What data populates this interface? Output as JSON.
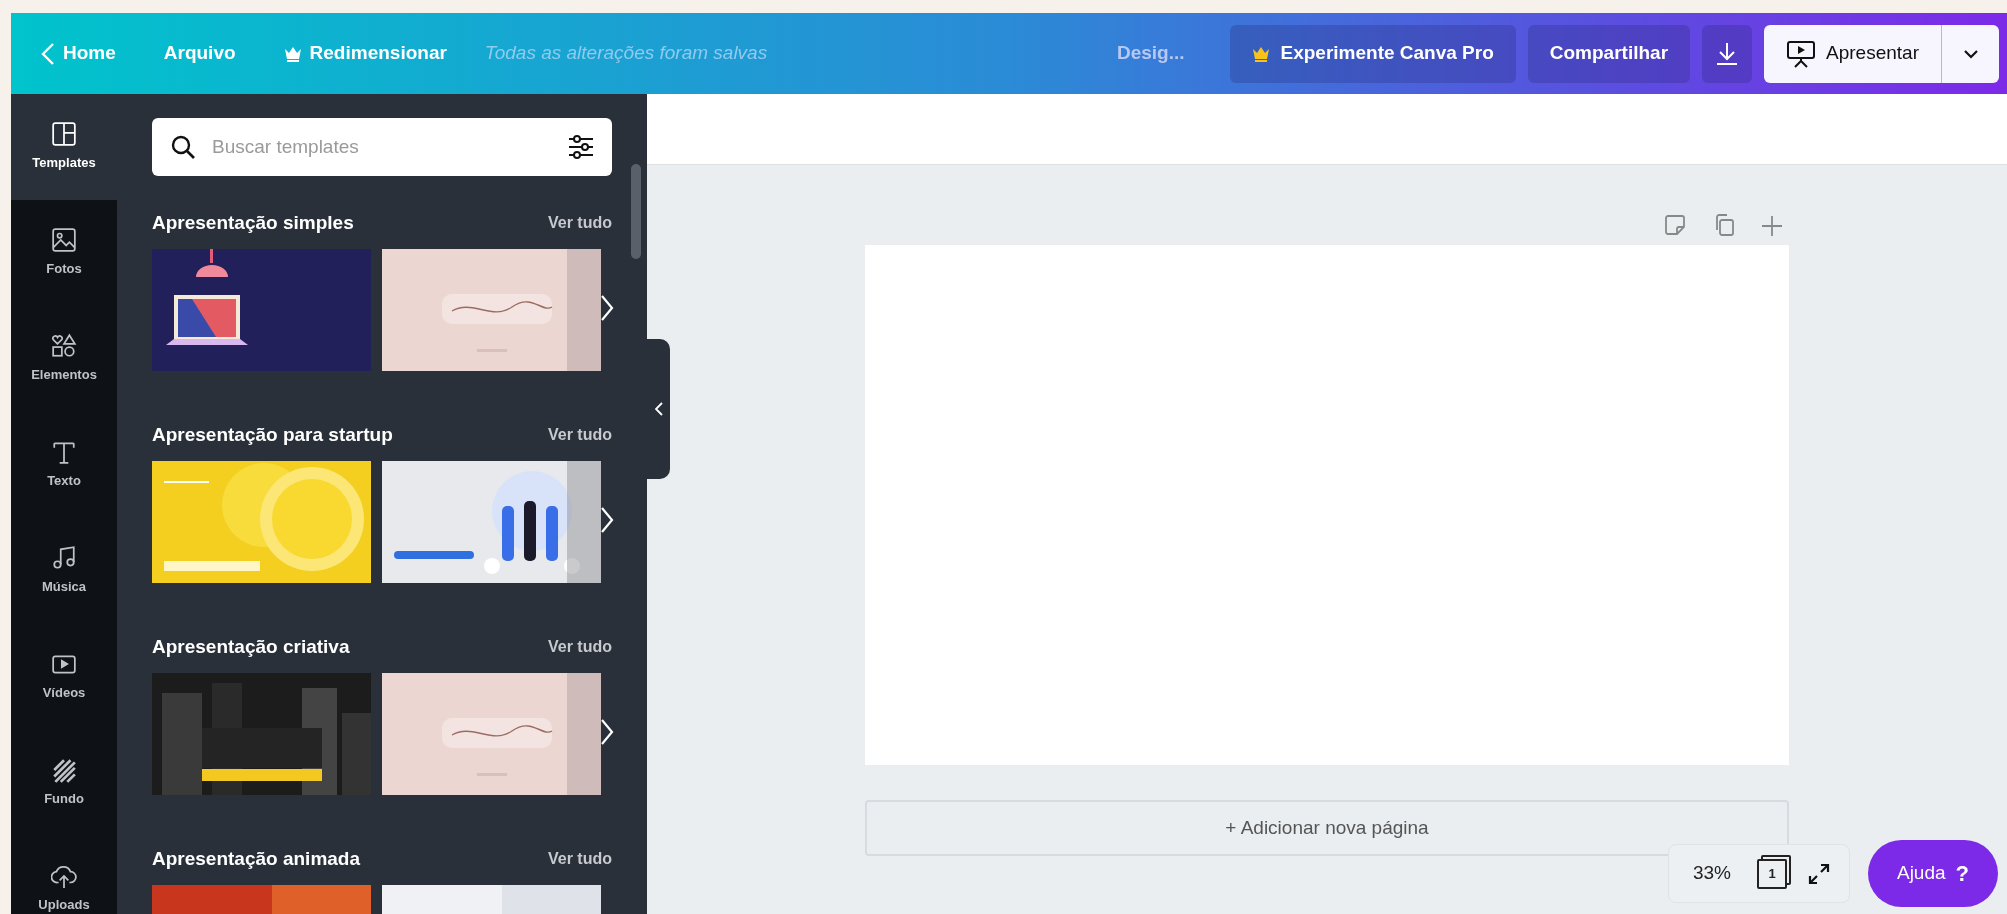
{
  "topbar": {
    "home": "Home",
    "menu": [
      {
        "label": "Arquivo",
        "kind": "plain"
      },
      {
        "label": "Redimensionar",
        "kind": "crown"
      }
    ],
    "status": "Todas as alterações foram salvas",
    "design_title": "Desig...",
    "pro_button": "Experimente Canva Pro",
    "share_button": "Compartilhar",
    "present_button": "Apresentar"
  },
  "rail": [
    {
      "label": "Templates",
      "kind": "templates",
      "selected": true
    },
    {
      "label": "Fotos",
      "kind": "photos",
      "selected": false
    },
    {
      "label": "Elementos",
      "kind": "elements",
      "selected": false
    },
    {
      "label": "Texto",
      "kind": "text",
      "selected": false
    },
    {
      "label": "Música",
      "kind": "music",
      "selected": false
    },
    {
      "label": "Vídeos",
      "kind": "videos",
      "selected": false
    },
    {
      "label": "Fundo",
      "kind": "background",
      "selected": false
    },
    {
      "label": "Uploads",
      "kind": "uploads",
      "selected": false
    }
  ],
  "search": {
    "placeholder": "Buscar templates"
  },
  "sections": [
    {
      "title": "Apresentação simples",
      "link": "Ver tudo"
    },
    {
      "title": "Apresentação para startup",
      "link": "Ver tudo"
    },
    {
      "title": "Apresentação criativa",
      "link": "Ver tudo"
    },
    {
      "title": "Apresentação animada",
      "link": "Ver tudo"
    }
  ],
  "canvas": {
    "add_page": "+ Adicionar nova página"
  },
  "footer": {
    "zoom": "33%",
    "page_count": "1",
    "help": "Ajuda",
    "help_glyph": "?"
  }
}
